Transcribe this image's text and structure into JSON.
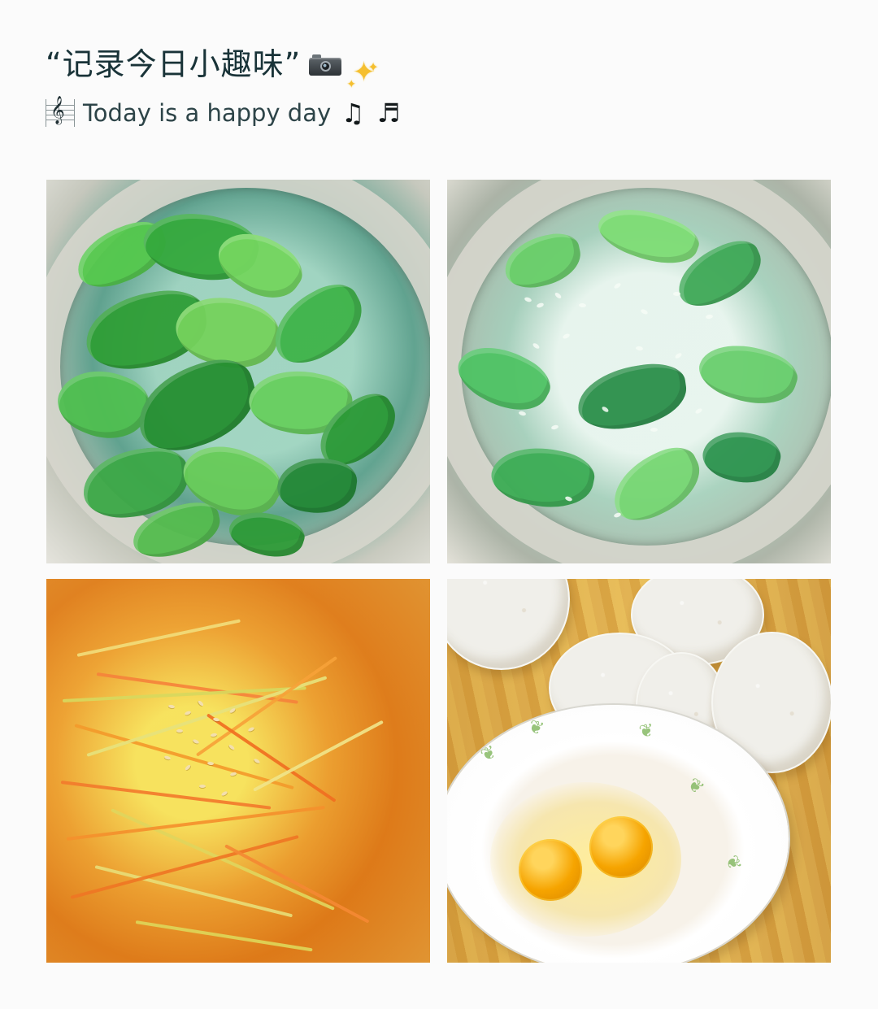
{
  "header": {
    "title": "“记录今日小趣味”",
    "title_icons": [
      "camera-icon",
      "sparkles-icon"
    ],
    "subtitle": "Today is a happy day",
    "subtitle_left_icon": "music-staff-icon",
    "subtitle_right_icons": [
      "double-music-note-icon",
      "music-note-icon"
    ]
  },
  "photos": [
    {
      "name": "green-leafy-vegetable-soup-photo"
    },
    {
      "name": "vegetable-rice-porridge-photo"
    },
    {
      "name": "shredded-potato-carrot-sesame-photo"
    },
    {
      "name": "bread-rounds-and-eggs-photo"
    }
  ],
  "glyphs": {
    "clef": "𝄞",
    "double_note": "♫",
    "single_note": "♬"
  },
  "colors": {
    "page_background": "#fbfbfb",
    "title_text": "#193338",
    "subtitle_text": "#2d4448"
  }
}
